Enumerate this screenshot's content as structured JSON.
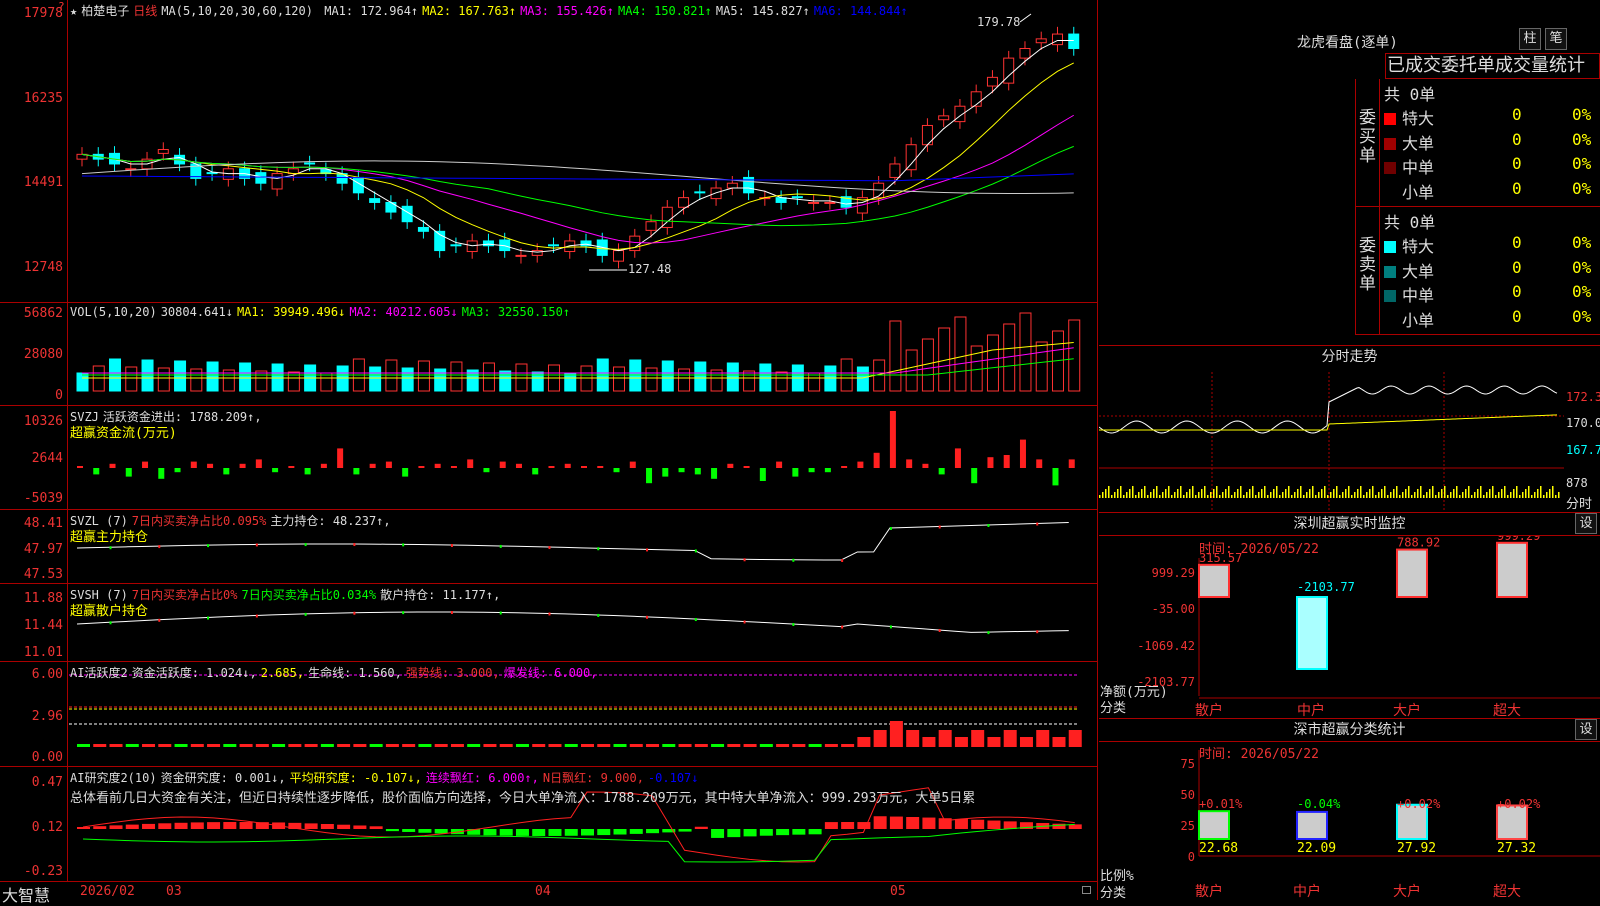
{
  "main": {
    "kline": {
      "stock_star": "★",
      "stock_name": "柏楚电子",
      "period": "日线",
      "ma_label": "MA(5,10,20,30,60,120)",
      "ma1": "MA1: 172.964↑",
      "ma2": "MA2: 167.763↑",
      "ma3": "MA3: 155.426↑",
      "ma4": "MA4: 150.821↑",
      "ma5": "MA5: 145.827↑",
      "ma6": "MA6: 144.844↑",
      "ticks": [
        "17978",
        "16235",
        "14491",
        "12748"
      ],
      "high_label": "179.78",
      "low_label": "127.48",
      "corner": "?"
    },
    "vol": {
      "label": "VOL(5,10,20)",
      "value": "30804.641↓",
      "ma1": "MA1: 39949.496↓",
      "ma2": "MA2: 40212.605↓",
      "ma3": "MA3: 32550.150↑",
      "ticks": [
        "56862",
        "28080",
        "0"
      ]
    },
    "svzj": {
      "label": "SVZJ",
      "text": "活跃资金进出: 1788.209↑,",
      "sub": "超赢资金流(万元)",
      "ticks": [
        "10326",
        "2644",
        "-5039"
      ]
    },
    "svzl": {
      "label": "SVZL (7)",
      "t1": "7日内买卖净占比0.095%",
      "t2": "主力持仓: 48.237↑,",
      "sub": "超赢主力持仓",
      "ticks": [
        "48.41",
        "47.97",
        "47.53"
      ]
    },
    "svsh": {
      "label": "SVSH (7)",
      "t1": "7日内买卖净占比0%",
      "t2": "7日内买卖净占比0.034%",
      "t3": "散户持仓: 11.177↑,",
      "sub": "超赢散户持仓",
      "ticks": [
        "11.88",
        "11.44",
        "11.01"
      ]
    },
    "ai1": {
      "label": "AI活跃度2",
      "t1": "资金活跃度: 1.024↓,",
      "t2": "2.685,",
      "t3": "生命线: 1.560,",
      "t4": "强势线: 3.000,",
      "t5": "爆发线: 6.000,",
      "ticks": [
        "6.00",
        "2.96",
        "0.00"
      ]
    },
    "ai2": {
      "label": "AI研究度2(10)",
      "t1": "资金研究度: 0.001↓,",
      "t2": "平均研究度: -0.107↓,",
      "t3": "连续飘红: 6.000↑,",
      "t4": "N日飘红: 9.000,",
      "t5": "-0.107↓",
      "summary": "总体看前几日大资金有关注，但近日持续性逐步降低，股价面临方向选择，今日大单净流入：1788.209万元，其中特大单净流入：999.293万元，大单5日累",
      "ticks": [
        "0.47",
        "0.12",
        "-0.23"
      ]
    },
    "bottom": {
      "brand": "大智慧",
      "months": [
        "2026/02",
        "03",
        "04",
        "05"
      ]
    }
  },
  "right": {
    "lhb": {
      "title": "龙虎看盘(逐单)",
      "btn1": "柱",
      "btn2": "笔",
      "tabs": "已成交委托单成交量统计"
    },
    "buy": {
      "side": "委买单",
      "total": "共 0单",
      "rows": [
        {
          "name": "特大",
          "n": "0",
          "pct": "0%",
          "color": "#ff0000"
        },
        {
          "name": "大单",
          "n": "0",
          "pct": "0%",
          "color": "#a00000"
        },
        {
          "name": "中单",
          "n": "0",
          "pct": "0%",
          "color": "#700000"
        },
        {
          "name": "小单",
          "n": "0",
          "pct": "0%",
          "color": "#000000"
        }
      ]
    },
    "sell": {
      "side": "委卖单",
      "total": "共 0单",
      "rows": [
        {
          "name": "特大",
          "n": "0",
          "pct": "0%",
          "color": "#00ffff"
        },
        {
          "name": "大单",
          "n": "0",
          "pct": "0%",
          "color": "#008080"
        },
        {
          "name": "中单",
          "n": "0",
          "pct": "0%",
          "color": "#006666"
        },
        {
          "name": "小单",
          "n": "0",
          "pct": "0%",
          "color": "#000000"
        }
      ]
    },
    "fenshi": {
      "title": "分时走势",
      "ticks": [
        "172.3",
        "170.0",
        "167.7",
        "878",
        "分时"
      ]
    },
    "szmon": {
      "title": "深圳超赢实时监控",
      "btn": "设",
      "time": "时间: 2026/05/22",
      "ticks": [
        "999.29",
        "-35.00",
        "-1069.42",
        "-2103.77"
      ],
      "unit": "净额(万元)",
      "cat_label": "分类",
      "cats": [
        "散户",
        "中户",
        "大户",
        "超大"
      ],
      "values": [
        315.57,
        -2103.77,
        788.92,
        999.29
      ],
      "labels": [
        "315.57",
        "-2103.77",
        "788.92",
        "999.29"
      ]
    },
    "szstat": {
      "title": "深市超赢分类统计",
      "btn": "设",
      "time": "时间: 2026/05/22",
      "ticks": [
        "75",
        "50",
        "25",
        "0"
      ],
      "unit": "比例%",
      "cat_label": "分类",
      "cats": [
        "散户",
        "中户",
        "大户",
        "超大"
      ],
      "pcts": [
        "+0.01%",
        "-0.04%",
        "+0.02%",
        "+0.02%"
      ],
      "values": [
        "22.68",
        "22.09",
        "27.92",
        "27.32"
      ],
      "heights": [
        22.68,
        22.09,
        27.92,
        27.32
      ]
    }
  }
}
